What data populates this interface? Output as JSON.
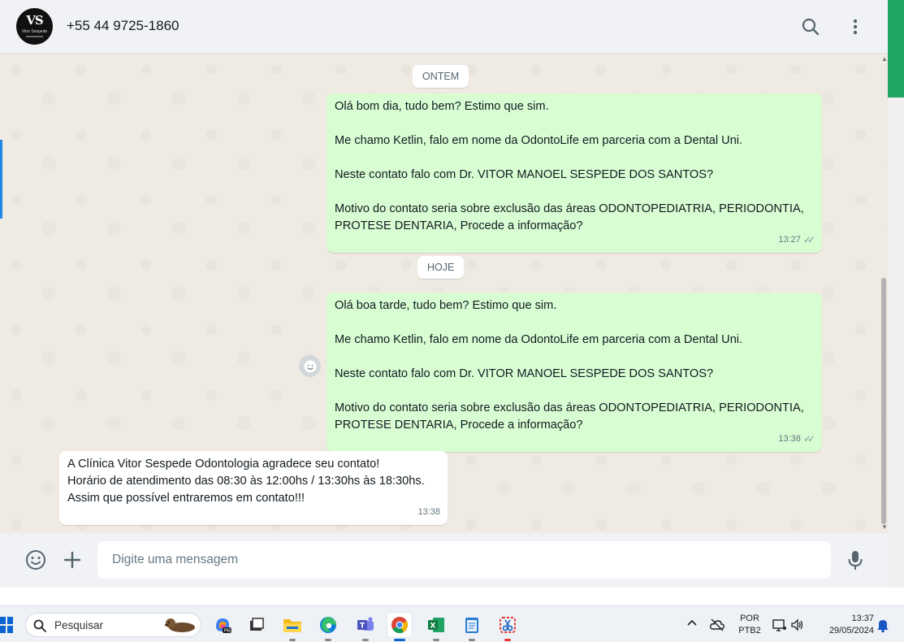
{
  "header": {
    "contact_name": "+55 44 9725-1860",
    "avatar_initials": "VS",
    "avatar_caption": "Vitor Sespede"
  },
  "chat": {
    "date_yesterday": "ONTEM",
    "date_today": "HOJE",
    "messages": [
      {
        "direction": "out",
        "lines": [
          "Olá bom dia, tudo bem? Estimo que sim.",
          "Me chamo Ketlin, falo em nome da OdontoLife em parceria com a Dental Uni.",
          "Neste contato falo com Dr. VITOR MANOEL SESPEDE DOS SANTOS?",
          "Motivo do contato seria sobre exclusão das áreas ODONTOPEDIATRIA, PERIODONTIA, PROTESE DENTARIA, Procede a informação?"
        ],
        "time": "13:27"
      },
      {
        "direction": "out",
        "lines": [
          "Olá boa tarde, tudo bem? Estimo que sim.",
          "Me chamo Ketlin, falo em nome da OdontoLife em parceria com a Dental Uni.",
          "Neste contato falo com Dr. VITOR MANOEL SESPEDE DOS SANTOS?",
          "Motivo do contato seria sobre exclusão das áreas ODONTOPEDIATRIA, PERIODONTIA, PROTESE DENTARIA, Procede a informação?"
        ],
        "time": "13:38"
      },
      {
        "direction": "in",
        "lines": [
          "A Clínica Vitor Sespede Odontologia agradece seu contato!",
          "Horário de atendimento das 08:30 às 12:00hs / 13:30hs às 18:30hs.",
          "Assim que possível entraremos em contato!!!"
        ],
        "time": "13:38"
      }
    ]
  },
  "composer": {
    "placeholder": "Digite uma mensagem"
  },
  "taskbar": {
    "search_label": "Pesquisar",
    "lang_top": "POR",
    "lang_bottom": "PTB2",
    "clock_time": "13:37",
    "clock_date": "29/05/2024",
    "apps": [
      "copilot",
      "task-view",
      "file-explorer",
      "edge",
      "teams",
      "chrome",
      "excel",
      "notepad",
      "snipping-tool"
    ]
  },
  "colors": {
    "outgoing_bubble": "#d9fdd3",
    "incoming_bubble": "#ffffff",
    "chat_background": "#efeae2",
    "header_background": "#f0f2f5"
  }
}
